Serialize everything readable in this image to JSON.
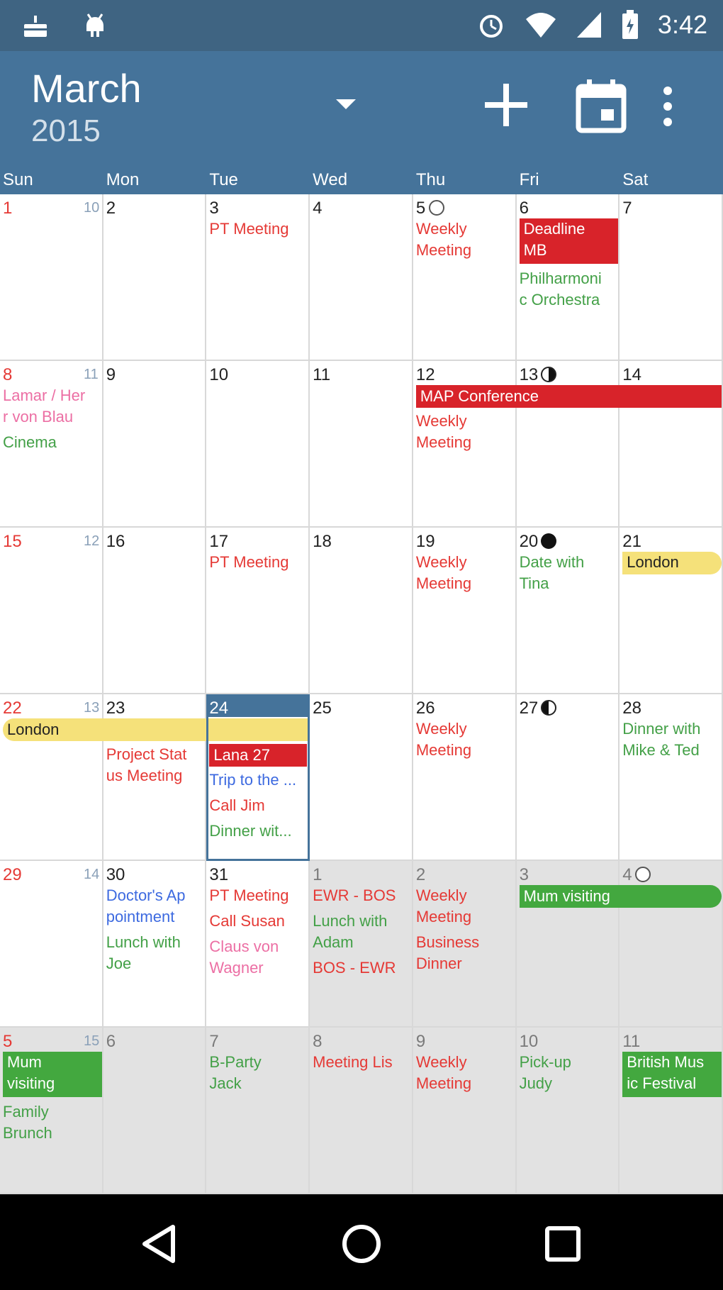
{
  "status_bar": {
    "time": "3:42",
    "left_icons": [
      "notification-cake-icon",
      "android-icon"
    ],
    "right_icons": [
      "alarm-icon",
      "wifi-icon",
      "signal-icon",
      "battery-icon"
    ]
  },
  "app_bar": {
    "month": "March",
    "year": "2015",
    "actions": [
      "dropdown-icon",
      "add-icon",
      "today-icon",
      "more-icon"
    ]
  },
  "weekdays": [
    "Sun",
    "Mon",
    "Tue",
    "Wed",
    "Thu",
    "Fri",
    "Sat"
  ],
  "weeks": [
    {
      "week_no": "10",
      "days": [
        {
          "d": "1"
        },
        {
          "d": "2"
        },
        {
          "d": "3",
          "events": [
            {
              "t": "PT Meeting",
              "c": "#e53935"
            }
          ]
        },
        {
          "d": "4"
        },
        {
          "d": "5",
          "moon": "full",
          "events": [
            {
              "t": "Weekly\nMeeting",
              "c": "#e53935"
            }
          ]
        },
        {
          "d": "6",
          "bar": {
            "t": "Deadline\nMB",
            "style": "red"
          },
          "events": [
            {
              "t": "Philharmoni\nc Orchestra",
              "c": "#43a047"
            }
          ]
        },
        {
          "d": "7"
        }
      ]
    },
    {
      "week_no": "11",
      "days": [
        {
          "d": "8",
          "events": [
            {
              "t": "Lamar / Her\nr von Blau",
              "c": "#ec6fa4"
            },
            {
              "t": "Cinema",
              "c": "#43a047"
            }
          ]
        },
        {
          "d": "9"
        },
        {
          "d": "10"
        },
        {
          "d": "11"
        },
        {
          "d": "12",
          "events": [
            {
              "t": "Weekly\nMeeting",
              "c": "#e53935"
            }
          ]
        },
        {
          "d": "13",
          "moon": "half"
        },
        {
          "d": "14"
        }
      ],
      "span_bar": {
        "t": "MAP Conference",
        "style": "red",
        "from": 4,
        "to": 6
      }
    },
    {
      "week_no": "12",
      "days": [
        {
          "d": "15"
        },
        {
          "d": "16"
        },
        {
          "d": "17",
          "events": [
            {
              "t": "PT Meeting",
              "c": "#e53935"
            }
          ]
        },
        {
          "d": "18"
        },
        {
          "d": "19",
          "events": [
            {
              "t": "Weekly\nMeeting",
              "c": "#e53935"
            }
          ]
        },
        {
          "d": "20",
          "moon": "new",
          "events": [
            {
              "t": "Date with\nTina",
              "c": "#43a047"
            }
          ]
        },
        {
          "d": "21",
          "bar": {
            "t": "London",
            "style": "yellow"
          }
        }
      ]
    },
    {
      "week_no": "13",
      "days": [
        {
          "d": "22"
        },
        {
          "d": "23",
          "events": [
            {
              "t": "Project Stat\nus Meeting",
              "c": "#e53935"
            }
          ]
        },
        {
          "d": "24",
          "today": true,
          "events": [
            {
              "t": "Trip to the ...",
              "c": "#3d6ae0"
            },
            {
              "t": "Call Jim",
              "c": "#e53935"
            },
            {
              "t": "Dinner wit...",
              "c": "#43a047"
            }
          ]
        },
        {
          "d": "25"
        },
        {
          "d": "26",
          "events": [
            {
              "t": "Weekly\nMeeting",
              "c": "#e53935"
            }
          ]
        },
        {
          "d": "27",
          "moon": "half-l"
        },
        {
          "d": "28",
          "events": [
            {
              "t": "Dinner with\nMike & Ted",
              "c": "#43a047"
            }
          ]
        }
      ],
      "span_bar": {
        "t": "London",
        "style": "yellow",
        "from": 0,
        "to": 2
      },
      "today_bar": {
        "t": "Lana 27",
        "style": "red"
      }
    },
    {
      "week_no": "14",
      "days": [
        {
          "d": "29"
        },
        {
          "d": "30",
          "events": [
            {
              "t": "Doctor's Ap\npointment",
              "c": "#3d6ae0"
            },
            {
              "t": "Lunch with\nJoe",
              "c": "#43a047"
            }
          ]
        },
        {
          "d": "31",
          "events": [
            {
              "t": "PT Meeting",
              "c": "#e53935"
            },
            {
              "t": "Call Susan",
              "c": "#e53935"
            },
            {
              "t": "Claus von\nWagner",
              "c": "#ec6fa4"
            }
          ]
        },
        {
          "d": "1",
          "out": true,
          "events": [
            {
              "t": "EWR - BOS",
              "c": "#e53935"
            },
            {
              "t": "Lunch with\nAdam",
              "c": "#43a047"
            },
            {
              "t": "BOS - EWR",
              "c": "#e53935"
            }
          ]
        },
        {
          "d": "2",
          "out": true,
          "events": [
            {
              "t": "Weekly\nMeeting",
              "c": "#e53935"
            },
            {
              "t": "Business\nDinner",
              "c": "#e53935"
            }
          ]
        },
        {
          "d": "3",
          "out": true
        },
        {
          "d": "4",
          "out": true,
          "moon": "full"
        }
      ],
      "span_bar": {
        "t": "Mum visiting",
        "style": "green",
        "from": 5,
        "to": 6
      }
    },
    {
      "week_no": "15",
      "days": [
        {
          "d": "5",
          "out": true,
          "bar": {
            "t": "Mum\nvisiting",
            "style": "green"
          },
          "events": [
            {
              "t": "Family\nBrunch",
              "c": "#43a047"
            }
          ]
        },
        {
          "d": "6",
          "out": true
        },
        {
          "d": "7",
          "out": true,
          "events": [
            {
              "t": "B-Party\nJack",
              "c": "#43a047"
            }
          ]
        },
        {
          "d": "8",
          "out": true,
          "events": [
            {
              "t": "Meeting Lis",
              "c": "#e53935"
            }
          ]
        },
        {
          "d": "9",
          "out": true,
          "events": [
            {
              "t": "Weekly\nMeeting",
              "c": "#e53935"
            }
          ]
        },
        {
          "d": "10",
          "out": true,
          "events": [
            {
              "t": "Pick-up\nJudy",
              "c": "#43a047"
            }
          ]
        },
        {
          "d": "11",
          "out": true,
          "bar": {
            "t": "British Mus\nic Festival",
            "style": "green"
          }
        }
      ]
    }
  ],
  "nav_bar": [
    "back-icon",
    "home-icon",
    "recents-icon"
  ]
}
